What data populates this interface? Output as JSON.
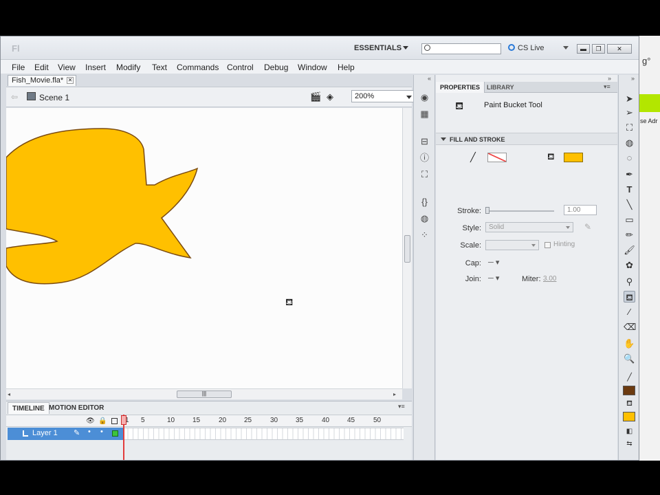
{
  "app": {
    "workspace": "ESSENTIALS",
    "search_placeholder": "",
    "cs_live": "CS Live",
    "logo": "Fl"
  },
  "menu": [
    "File",
    "Edit",
    "View",
    "Insert",
    "Modify",
    "Text",
    "Commands",
    "Control",
    "Debug",
    "Window",
    "Help"
  ],
  "document": {
    "tab_label": "Fish_Movie.fla*",
    "scene": "Scene 1",
    "zoom": "200%"
  },
  "timeline": {
    "tabs": [
      "TIMELINE",
      "MOTION EDITOR"
    ],
    "frame_numbers": [
      "1",
      "5",
      "10",
      "15",
      "20",
      "25",
      "30",
      "35",
      "40",
      "45",
      "50"
    ],
    "layer_name": "Layer 1",
    "current_frame": 1
  },
  "properties": {
    "tabs": [
      "PROPERTIES",
      "LIBRARY"
    ],
    "tool_name": "Paint Bucket Tool",
    "section": "FILL AND STROKE",
    "stroke_label": "Stroke:",
    "stroke_value": "1.00",
    "style_label": "Style:",
    "style_value": "Solid",
    "scale_label": "Scale:",
    "hinting_label": "Hinting",
    "cap_label": "Cap:",
    "join_label": "Join:",
    "miter_label": "Miter:",
    "miter_value": "3.00",
    "fill_color": "#ffc000"
  },
  "stage": {
    "fish_fill": "#ffc000",
    "fish_stroke": "#7a4a10"
  },
  "toolbox": {
    "stroke_color": "#6b3a10",
    "fill_color": "#ffc000",
    "icons": [
      "selection-icon",
      "subselection-icon",
      "free-transform-icon",
      "3d-rotation-icon",
      "lasso-icon",
      "pen-icon",
      "text-icon",
      "line-icon",
      "rectangle-icon",
      "pencil-icon",
      "brush-icon",
      "deco-icon",
      "bone-icon",
      "paint-bucket-icon",
      "eyedropper-icon",
      "eraser-icon",
      "hand-icon",
      "zoom-icon"
    ]
  },
  "background_window": {
    "degree_text": "g°",
    "snippet_text": "se Adr"
  }
}
